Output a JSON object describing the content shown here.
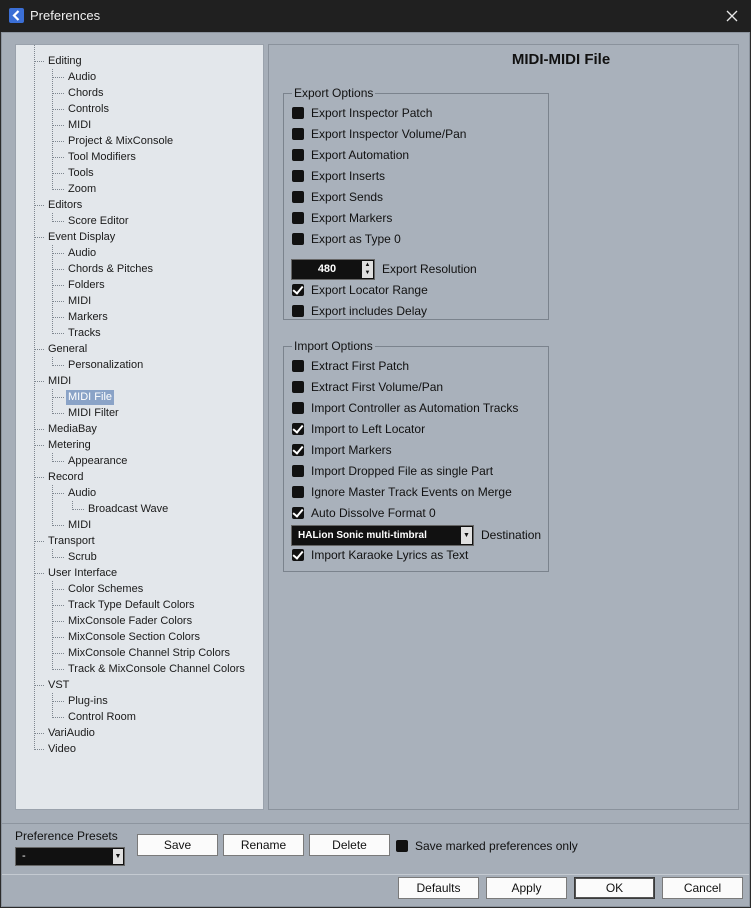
{
  "window": {
    "title": "Preferences"
  },
  "tree": [
    {
      "label": "Editing",
      "level": 0
    },
    {
      "label": "Audio",
      "level": 1
    },
    {
      "label": "Chords",
      "level": 1
    },
    {
      "label": "Controls",
      "level": 1
    },
    {
      "label": "MIDI",
      "level": 1
    },
    {
      "label": "Project & MixConsole",
      "level": 1
    },
    {
      "label": "Tool Modifiers",
      "level": 1
    },
    {
      "label": "Tools",
      "level": 1
    },
    {
      "label": "Zoom",
      "level": 1
    },
    {
      "label": "Editors",
      "level": 0
    },
    {
      "label": "Score Editor",
      "level": 1
    },
    {
      "label": "Event Display",
      "level": 0
    },
    {
      "label": "Audio",
      "level": 1
    },
    {
      "label": "Chords & Pitches",
      "level": 1
    },
    {
      "label": "Folders",
      "level": 1
    },
    {
      "label": "MIDI",
      "level": 1
    },
    {
      "label": "Markers",
      "level": 1
    },
    {
      "label": "Tracks",
      "level": 1
    },
    {
      "label": "General",
      "level": 0
    },
    {
      "label": "Personalization",
      "level": 1
    },
    {
      "label": "MIDI",
      "level": 0
    },
    {
      "label": "MIDI File",
      "level": 1,
      "selected": true
    },
    {
      "label": "MIDI Filter",
      "level": 1
    },
    {
      "label": "MediaBay",
      "level": 0
    },
    {
      "label": "Metering",
      "level": 0
    },
    {
      "label": "Appearance",
      "level": 1
    },
    {
      "label": "Record",
      "level": 0
    },
    {
      "label": "Audio",
      "level": 1
    },
    {
      "label": "Broadcast Wave",
      "level": 2
    },
    {
      "label": "MIDI",
      "level": 1
    },
    {
      "label": "Transport",
      "level": 0
    },
    {
      "label": "Scrub",
      "level": 1
    },
    {
      "label": "User Interface",
      "level": 0
    },
    {
      "label": "Color Schemes",
      "level": 1
    },
    {
      "label": "Track Type Default Colors",
      "level": 1
    },
    {
      "label": "MixConsole Fader Colors",
      "level": 1
    },
    {
      "label": "MixConsole Section Colors",
      "level": 1
    },
    {
      "label": "MixConsole Channel Strip Colors",
      "level": 1
    },
    {
      "label": "Track & MixConsole Channel Colors",
      "level": 1
    },
    {
      "label": "VST",
      "level": 0
    },
    {
      "label": "Plug-ins",
      "level": 1
    },
    {
      "label": "Control Room",
      "level": 1
    },
    {
      "label": "VariAudio",
      "level": 0
    },
    {
      "label": "Video",
      "level": 0
    }
  ],
  "page": {
    "title": "MIDI-MIDI File"
  },
  "export": {
    "label": "Export Options",
    "options": [
      {
        "label": "Export Inspector Patch",
        "checked": false
      },
      {
        "label": "Export Inspector Volume/Pan",
        "checked": false
      },
      {
        "label": "Export Automation",
        "checked": false
      },
      {
        "label": "Export Inserts",
        "checked": false
      },
      {
        "label": "Export Sends",
        "checked": false
      },
      {
        "label": "Export Markers",
        "checked": false
      },
      {
        "label": "Export as Type 0",
        "checked": false
      }
    ],
    "resolution_value": "480",
    "resolution_label": "Export Resolution",
    "options_after": [
      {
        "label": "Export Locator Range",
        "checked": true
      },
      {
        "label": "Export includes Delay",
        "checked": false
      }
    ]
  },
  "import": {
    "label": "Import Options",
    "options": [
      {
        "label": "Extract First Patch",
        "checked": false
      },
      {
        "label": "Extract First Volume/Pan",
        "checked": false
      },
      {
        "label": "Import Controller as Automation Tracks",
        "checked": false
      },
      {
        "label": "Import to Left Locator",
        "checked": true
      },
      {
        "label": "Import Markers",
        "checked": true
      },
      {
        "label": "Import Dropped File as single Part",
        "checked": false
      },
      {
        "label": "Ignore Master Track Events on Merge",
        "checked": false
      },
      {
        "label": "Auto Dissolve Format 0",
        "checked": true
      }
    ],
    "destination_value": "HALion Sonic multi-timbral",
    "destination_label": "Destination",
    "options_after": [
      {
        "label": "Import Karaoke Lyrics as Text",
        "checked": true
      }
    ]
  },
  "presets": {
    "label": "Preference Presets",
    "selected": "-",
    "save_label": "Save",
    "rename_label": "Rename",
    "delete_label": "Delete",
    "save_marked_label": "Save marked preferences only"
  },
  "footer": {
    "defaults_label": "Defaults",
    "apply_label": "Apply",
    "ok_label": "OK",
    "cancel_label": "Cancel"
  }
}
